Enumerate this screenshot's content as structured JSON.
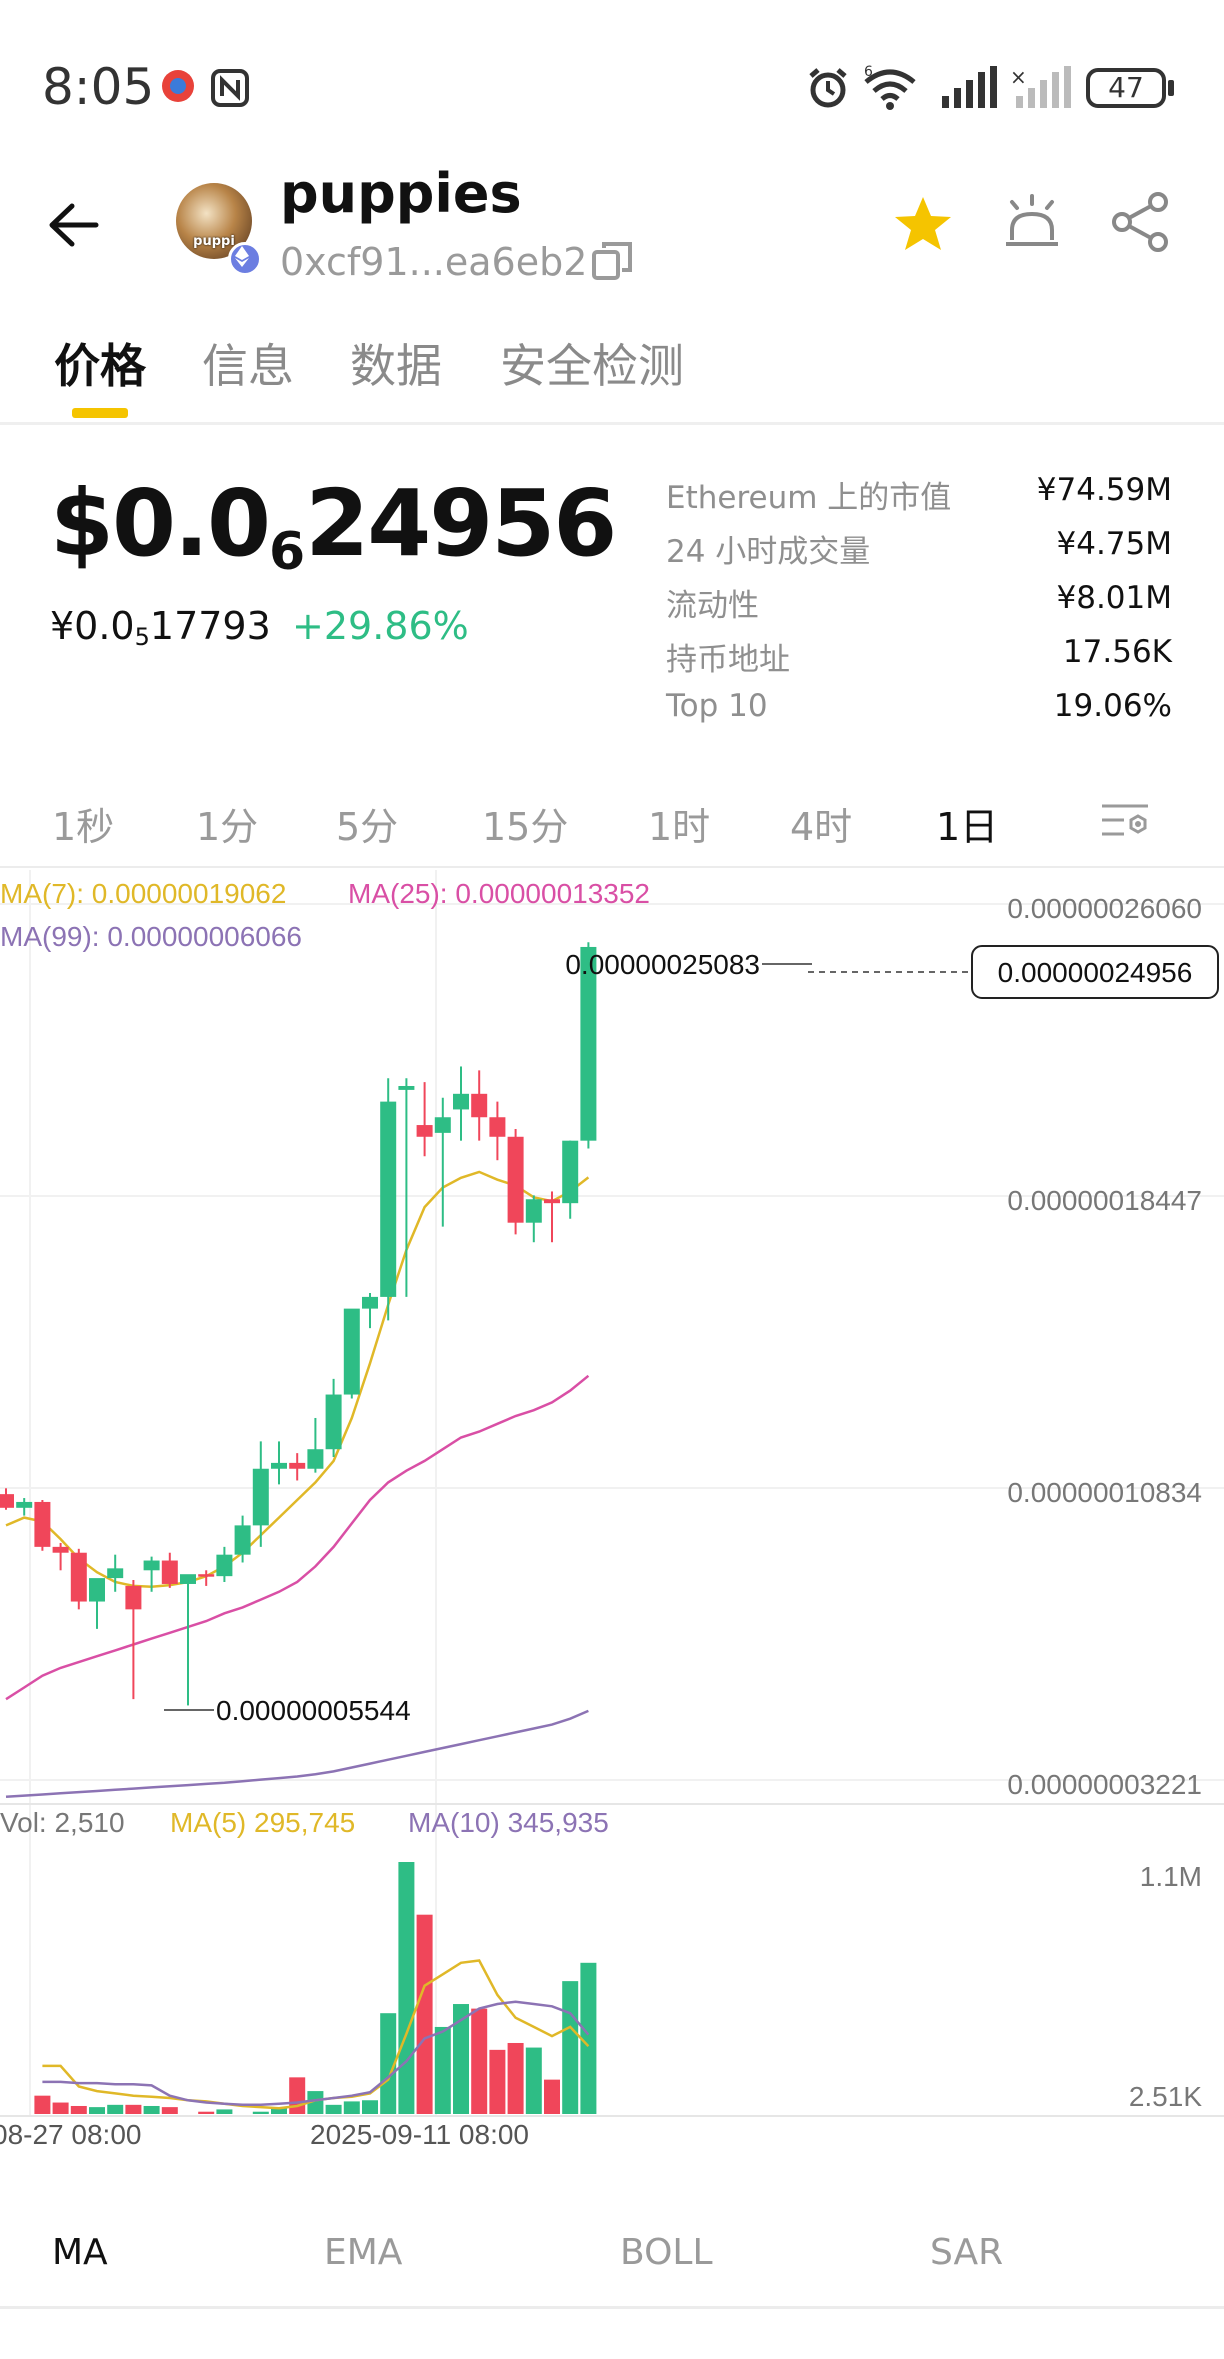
{
  "status_bar": {
    "time": "8:05",
    "battery": "47",
    "icons": [
      "notification-app-icon",
      "nfc-icon",
      "alarm-icon",
      "wifi-icon",
      "signal-icon",
      "signal-no-service-icon",
      "battery-icon"
    ]
  },
  "header": {
    "token_name": "puppies",
    "avatar_label": "puppi",
    "address": "0xcf91...ea6eb2",
    "chain_icon": "ethereum-icon",
    "accent": "#f5c400"
  },
  "tabs": [
    {
      "label": "价格",
      "active": true
    },
    {
      "label": "信息",
      "active": false
    },
    {
      "label": "数据",
      "active": false
    },
    {
      "label": "安全检测",
      "active": false
    }
  ],
  "price": {
    "main_prefix": "$0.0",
    "main_sub": "6",
    "main_suffix": "24956",
    "cny_prefix": "¥0.0",
    "cny_sub": "5",
    "cny_suffix": "17793",
    "change": "+29.86%",
    "change_color": "#2ebd85"
  },
  "stats": [
    {
      "label": "Ethereum 上的市值",
      "value": "¥74.59M"
    },
    {
      "label": "24 小时成交量",
      "value": "¥4.75M"
    },
    {
      "label": "流动性",
      "value": "¥8.01M"
    },
    {
      "label": "持币地址",
      "value": "17.56K"
    },
    {
      "label": "Top 10",
      "value": "19.06%"
    }
  ],
  "intervals": [
    {
      "label": "1秒",
      "active": false
    },
    {
      "label": "1分",
      "active": false
    },
    {
      "label": "5分",
      "active": false
    },
    {
      "label": "15分",
      "active": false
    },
    {
      "label": "1时",
      "active": false
    },
    {
      "label": "4时",
      "active": false
    },
    {
      "label": "1日",
      "active": true
    }
  ],
  "chart": {
    "ma7_label": "MA(7): 0.00000019062",
    "ma25_label": "MA(25): 0.00000013352",
    "ma99_label": "MA(99): 0.00000006066",
    "price_ticks": [
      "0.00000026060",
      "0.00000018447",
      "0.00000010834",
      "0.00000003221"
    ],
    "current_price_tag": "0.00000024956",
    "high_label": "0.00000025083",
    "low_label": "0.00000005544",
    "vol_label": "Vol: 2,510",
    "vol_ma5_label": "MA(5) 295,745",
    "vol_ma10_label": "MA(10) 345,935",
    "vol_ticks": [
      "1.1M",
      "2.51K"
    ],
    "date_labels": [
      "08-27 08:00",
      "2025-09-11 08:00"
    ],
    "colors": {
      "up": "#2ebd85",
      "down": "#f0465a",
      "ma7": "#e0b828",
      "ma25": "#d94fa5",
      "ma99": "#8c73b4"
    }
  },
  "chart_data": {
    "type": "candlestick",
    "x_start_label": "08-27 08:00",
    "ylim": [
      3.221e-08,
      2.606e-07
    ],
    "candles": [
      {
        "o": 1.095e-07,
        "h": 1.11e-07,
        "l": 1.055e-07,
        "c": 1.06e-07
      },
      {
        "o": 1.06e-07,
        "h": 1.085e-07,
        "l": 1.04e-07,
        "c": 1.075e-07
      },
      {
        "o": 1.075e-07,
        "h": 1.08e-07,
        "l": 9.5e-08,
        "c": 9.6e-08
      },
      {
        "o": 9.6e-08,
        "h": 9.7e-08,
        "l": 9e-08,
        "c": 9.45e-08
      },
      {
        "o": 9.45e-08,
        "h": 9.55e-08,
        "l": 8e-08,
        "c": 8.2e-08
      },
      {
        "o": 8.2e-08,
        "h": 8.6e-08,
        "l": 7.5e-08,
        "c": 8.8e-08
      },
      {
        "o": 8.8e-08,
        "h": 9.4e-08,
        "l": 8.45e-08,
        "c": 9.05e-08
      },
      {
        "o": 8.6e-08,
        "h": 8.75e-08,
        "l": 5.7e-08,
        "c": 8e-08
      },
      {
        "o": 9e-08,
        "h": 9.35e-08,
        "l": 8.45e-08,
        "c": 9.25e-08
      },
      {
        "o": 9.25e-08,
        "h": 9.45e-08,
        "l": 8.55e-08,
        "c": 8.65e-08
      },
      {
        "o": 8.65e-08,
        "h": 8.8e-08,
        "l": 5.54e-08,
        "c": 8.9e-08
      },
      {
        "o": 8.9e-08,
        "h": 9e-08,
        "l": 8.6e-08,
        "c": 8.85e-08
      },
      {
        "o": 8.85e-08,
        "h": 9.6e-08,
        "l": 8.7e-08,
        "c": 9.4e-08
      },
      {
        "o": 9.4e-08,
        "h": 1.04e-07,
        "l": 9.2e-08,
        "c": 1.015e-07
      },
      {
        "o": 1.015e-07,
        "h": 1.23e-07,
        "l": 9.6e-08,
        "c": 1.16e-07
      },
      {
        "o": 1.16e-07,
        "h": 1.23e-07,
        "l": 1.12e-07,
        "c": 1.175e-07
      },
      {
        "o": 1.175e-07,
        "h": 1.2e-07,
        "l": 1.13e-07,
        "c": 1.16e-07
      },
      {
        "o": 1.16e-07,
        "h": 1.29e-07,
        "l": 1.15e-07,
        "c": 1.21e-07
      },
      {
        "o": 1.21e-07,
        "h": 1.39e-07,
        "l": 1.19e-07,
        "c": 1.35e-07
      },
      {
        "o": 1.35e-07,
        "h": 1.56e-07,
        "l": 1.34e-07,
        "c": 1.57e-07
      },
      {
        "o": 1.57e-07,
        "h": 1.61e-07,
        "l": 1.52e-07,
        "c": 1.6e-07
      },
      {
        "o": 1.6e-07,
        "h": 2.16e-07,
        "l": 1.54e-07,
        "c": 2.1e-07
      },
      {
        "o": 2.13e-07,
        "h": 2.16e-07,
        "l": 1.6e-07,
        "c": 2.14e-07
      },
      {
        "o": 2.04e-07,
        "h": 2.15e-07,
        "l": 1.96e-07,
        "c": 2.01e-07
      },
      {
        "o": 2.02e-07,
        "h": 2.11e-07,
        "l": 1.78e-07,
        "c": 2.06e-07
      },
      {
        "o": 2.08e-07,
        "h": 2.19e-07,
        "l": 2e-07,
        "c": 2.12e-07
      },
      {
        "o": 2.12e-07,
        "h": 2.18e-07,
        "l": 2e-07,
        "c": 2.06e-07
      },
      {
        "o": 2.06e-07,
        "h": 2.1e-07,
        "l": 1.95e-07,
        "c": 2.01e-07
      },
      {
        "o": 2.01e-07,
        "h": 2.03e-07,
        "l": 1.76e-07,
        "c": 1.79e-07
      },
      {
        "o": 1.79e-07,
        "h": 1.86e-07,
        "l": 1.74e-07,
        "c": 1.85e-07
      },
      {
        "o": 1.85e-07,
        "h": 1.87e-07,
        "l": 1.74e-07,
        "c": 1.84e-07
      },
      {
        "o": 1.84e-07,
        "h": 2e-07,
        "l": 1.8e-07,
        "c": 2e-07
      },
      {
        "o": 2e-07,
        "h": 2.508e-07,
        "l": 1.98e-07,
        "c": 2.496e-07
      }
    ],
    "ma7": [
      1.015e-07,
      1.035e-07,
      1.025e-07,
      9.8e-08,
      9.3e-08,
      8.95e-08,
      8.7e-08,
      8.6e-08,
      8.58e-08,
      8.62e-08,
      8.7e-08,
      8.85e-08,
      9.1e-08,
      9.45e-08,
      9.9e-08,
      1.035e-07,
      1.08e-07,
      1.125e-07,
      1.18e-07,
      1.29e-07,
      1.43e-07,
      1.58e-07,
      1.72e-07,
      1.83e-07,
      1.88e-07,
      1.905e-07,
      1.92e-07,
      1.9e-07,
      1.885e-07,
      1.855e-07,
      1.845e-07,
      1.87e-07,
      1.906e-07
    ],
    "ma25": [
      5.7e-08,
      6e-08,
      6.3e-08,
      6.5e-08,
      6.65e-08,
      6.8e-08,
      6.95e-08,
      7.1e-08,
      7.25e-08,
      7.4e-08,
      7.55e-08,
      7.7e-08,
      7.9e-08,
      8.05e-08,
      8.25e-08,
      8.45e-08,
      8.7e-08,
      9.1e-08,
      9.6e-08,
      1.02e-07,
      1.08e-07,
      1.125e-07,
      1.155e-07,
      1.18e-07,
      1.21e-07,
      1.24e-07,
      1.255e-07,
      1.275e-07,
      1.295e-07,
      1.31e-07,
      1.33e-07,
      1.36e-07,
      1.398e-07
    ],
    "ma99": [
      3.2e-08,
      3.23e-08,
      3.26e-08,
      3.29e-08,
      3.32e-08,
      3.35e-08,
      3.38e-08,
      3.41e-08,
      3.44e-08,
      3.47e-08,
      3.5e-08,
      3.53e-08,
      3.56e-08,
      3.6e-08,
      3.64e-08,
      3.68e-08,
      3.72e-08,
      3.78e-08,
      3.85e-08,
      3.95e-08,
      4.05e-08,
      4.15e-08,
      4.25e-08,
      4.35e-08,
      4.45e-08,
      4.55e-08,
      4.65e-08,
      4.75e-08,
      4.85e-08,
      4.95e-08,
      5.05e-08,
      5.2e-08,
      5.4e-08
    ],
    "volume": [
      80000,
      50000,
      35000,
      30000,
      40000,
      40000,
      35000,
      30000,
      0,
      10000,
      20000,
      0,
      10000,
      25000,
      160000,
      100000,
      40000,
      55000,
      60000,
      440000,
      1100000,
      870000,
      380000,
      480000,
      460000,
      280000,
      310000,
      290000,
      150000,
      580000,
      660000
    ],
    "vol_ma5": [
      210000,
      210000,
      120000,
      100000,
      90000,
      80000,
      75000,
      70000,
      60000,
      55000,
      45000,
      35000,
      30000,
      25000,
      35000,
      60000,
      70000,
      75000,
      90000,
      150000,
      350000,
      560000,
      610000,
      660000,
      670000,
      520000,
      420000,
      380000,
      340000,
      380000,
      296000
    ],
    "vol_ma10": [
      140000,
      140000,
      135000,
      135000,
      130000,
      130000,
      125000,
      80000,
      60000,
      50000,
      45000,
      40000,
      40000,
      45000,
      50000,
      60000,
      70000,
      80000,
      95000,
      160000,
      230000,
      330000,
      360000,
      410000,
      460000,
      480000,
      490000,
      480000,
      470000,
      440000,
      346000
    ],
    "price_ticks": [
      "0.00000026060",
      "0.00000018447",
      "0.00000010834",
      "0.00000003221"
    ],
    "vol_ticks": [
      "1.1M",
      "2.51K"
    ]
  },
  "indicators": [
    {
      "label": "MA",
      "active": true
    },
    {
      "label": "EMA",
      "active": false
    },
    {
      "label": "BOLL",
      "active": false
    },
    {
      "label": "SAR",
      "active": false
    }
  ]
}
